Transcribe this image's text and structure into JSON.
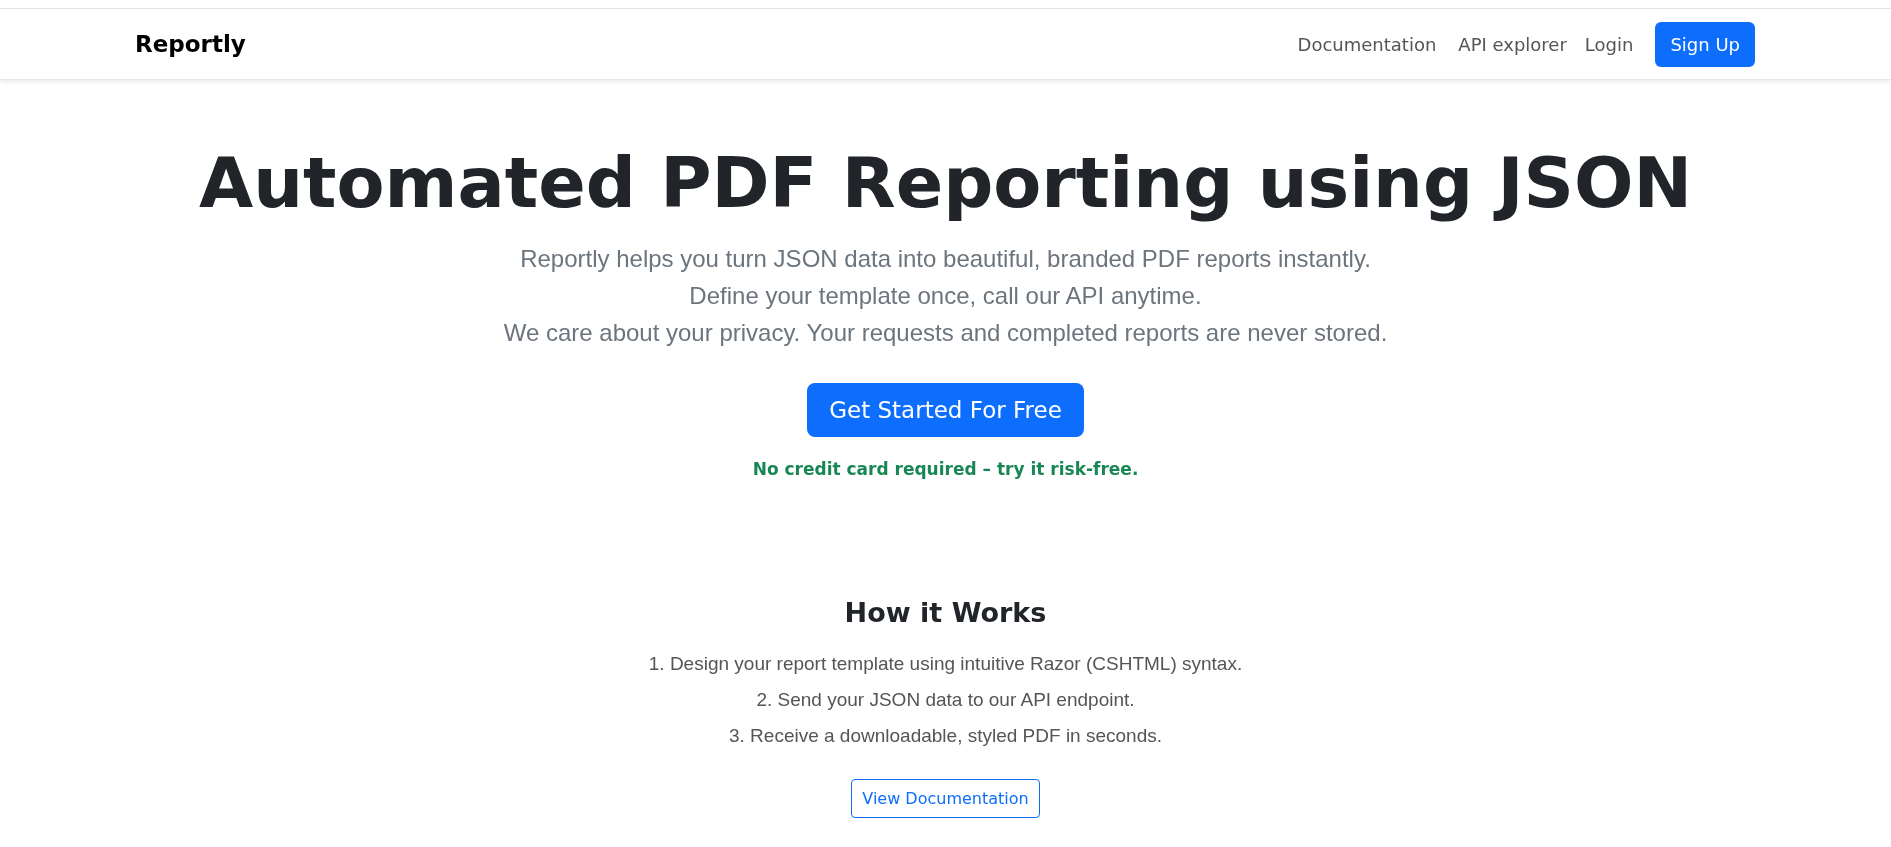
{
  "navbar": {
    "brand": "Reportly",
    "links": [
      {
        "label": "Documentation",
        "kind": "link"
      },
      {
        "label": "API explorer",
        "kind": "link"
      },
      {
        "label": "Login",
        "kind": "link"
      },
      {
        "label": "Sign Up",
        "kind": "button"
      }
    ]
  },
  "hero": {
    "title": "Automated PDF Reporting using JSON",
    "lines": [
      "Reportly helps you turn JSON data into beautiful, branded PDF reports instantly.",
      "Define your template once, call our API anytime.",
      "We care about your privacy. Your requests and completed reports are never stored."
    ],
    "cta": "Get Started For Free",
    "note": "No credit card required – try it risk-free."
  },
  "how_it_works": {
    "heading": "How it Works",
    "steps": [
      "1. Design your report template using intuitive Razor (CSHTML) syntax.",
      "2. Send your JSON data to our API endpoint.",
      "3. Receive a downloadable, styled PDF in seconds."
    ],
    "button": "View Documentation"
  }
}
